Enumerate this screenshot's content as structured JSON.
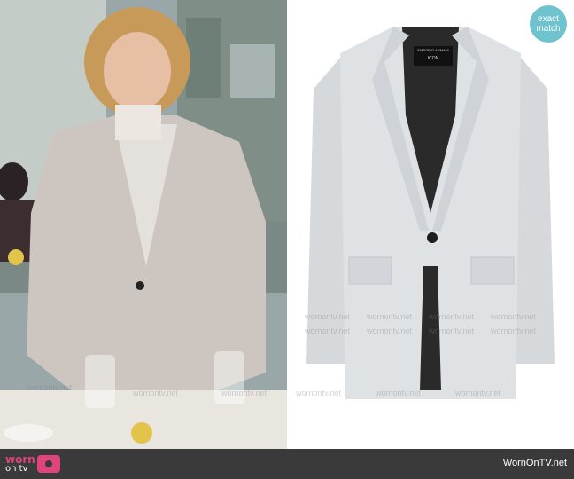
{
  "badge": {
    "line1": "exact",
    "line2": "match"
  },
  "footer": {
    "logo_top": "worn",
    "logo_bottom": "on tv",
    "site": "WornOnTV.net"
  },
  "watermark_text": "wornontv.net",
  "product": {
    "label_line1": "EMPORIO ARMANI",
    "label_line2": "ICON"
  },
  "colors": {
    "badge": "#6fc3cf",
    "footer": "#3a3a3a",
    "brand_pink": "#e0447c",
    "blazer": "#d9dcdf"
  }
}
